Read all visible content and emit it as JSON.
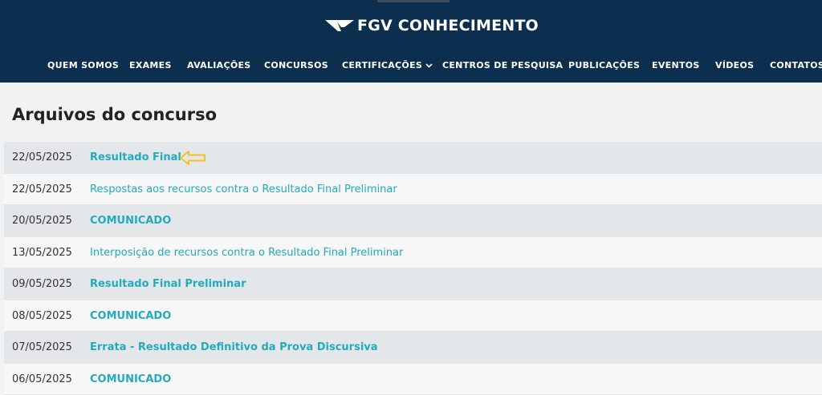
{
  "header": {
    "brand": "FGV CONHECIMENTO",
    "nav": [
      {
        "label": "QUEM SOMOS"
      },
      {
        "label": "EXAMES"
      },
      {
        "label": "AVALIAÇÕES"
      },
      {
        "label": "CONCURSOS"
      },
      {
        "label": "CERTIFICAÇÕES"
      },
      {
        "label": "CENTROS DE PESQUISA"
      },
      {
        "label": "PUBLICAÇÕES"
      },
      {
        "label": "EVENTOS"
      },
      {
        "label": "VÍDEOS"
      },
      {
        "label": "CONTATOS"
      }
    ]
  },
  "main": {
    "title": "Arquivos do concurso",
    "files": [
      {
        "date": "22/05/2025",
        "label": "Resultado Final"
      },
      {
        "date": "22/05/2025",
        "label": "Respostas aos recursos contra o Resultado Final Preliminar"
      },
      {
        "date": "20/05/2025",
        "label": "COMUNICADO"
      },
      {
        "date": "13/05/2025",
        "label": "Interposição de recursos contra o Resultado Final Preliminar"
      },
      {
        "date": "09/05/2025",
        "label": "Resultado Final Preliminar"
      },
      {
        "date": "08/05/2025",
        "label": "COMUNICADO"
      },
      {
        "date": "07/05/2025",
        "label": "Errata - Resultado Definitivo da Prova Discursiva"
      },
      {
        "date": "06/05/2025",
        "label": "COMUNICADO"
      }
    ]
  },
  "colors": {
    "header_bg": "#0c2f4f",
    "link": "#22aabd",
    "arrow": "#f5c022"
  },
  "icons": {
    "logo": "fgv-wing-logo",
    "dropdown": "chevron-down-icon",
    "highlight": "arrow-left-icon"
  }
}
